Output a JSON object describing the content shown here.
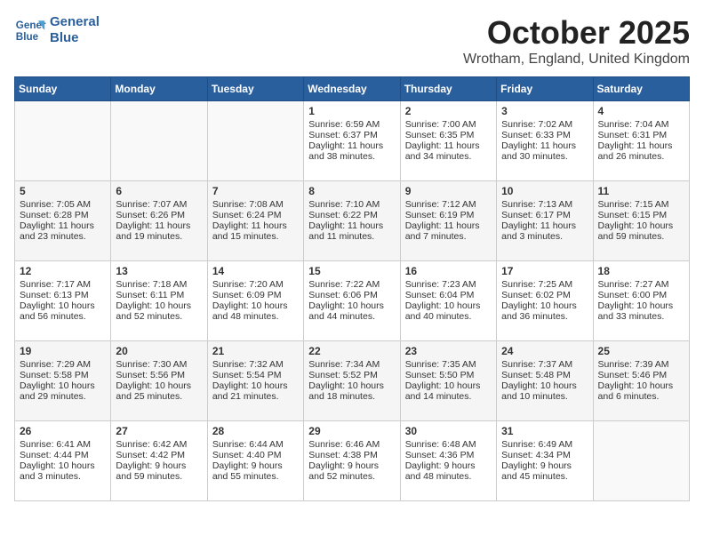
{
  "header": {
    "logo_general": "General",
    "logo_blue": "Blue",
    "month_title": "October 2025",
    "location": "Wrotham, England, United Kingdom"
  },
  "days_of_week": [
    "Sunday",
    "Monday",
    "Tuesday",
    "Wednesday",
    "Thursday",
    "Friday",
    "Saturday"
  ],
  "weeks": [
    [
      {
        "day": "",
        "content": ""
      },
      {
        "day": "",
        "content": ""
      },
      {
        "day": "",
        "content": ""
      },
      {
        "day": "1",
        "content": "Sunrise: 6:59 AM\nSunset: 6:37 PM\nDaylight: 11 hours and 38 minutes."
      },
      {
        "day": "2",
        "content": "Sunrise: 7:00 AM\nSunset: 6:35 PM\nDaylight: 11 hours and 34 minutes."
      },
      {
        "day": "3",
        "content": "Sunrise: 7:02 AM\nSunset: 6:33 PM\nDaylight: 11 hours and 30 minutes."
      },
      {
        "day": "4",
        "content": "Sunrise: 7:04 AM\nSunset: 6:31 PM\nDaylight: 11 hours and 26 minutes."
      }
    ],
    [
      {
        "day": "5",
        "content": "Sunrise: 7:05 AM\nSunset: 6:28 PM\nDaylight: 11 hours and 23 minutes."
      },
      {
        "day": "6",
        "content": "Sunrise: 7:07 AM\nSunset: 6:26 PM\nDaylight: 11 hours and 19 minutes."
      },
      {
        "day": "7",
        "content": "Sunrise: 7:08 AM\nSunset: 6:24 PM\nDaylight: 11 hours and 15 minutes."
      },
      {
        "day": "8",
        "content": "Sunrise: 7:10 AM\nSunset: 6:22 PM\nDaylight: 11 hours and 11 minutes."
      },
      {
        "day": "9",
        "content": "Sunrise: 7:12 AM\nSunset: 6:19 PM\nDaylight: 11 hours and 7 minutes."
      },
      {
        "day": "10",
        "content": "Sunrise: 7:13 AM\nSunset: 6:17 PM\nDaylight: 11 hours and 3 minutes."
      },
      {
        "day": "11",
        "content": "Sunrise: 7:15 AM\nSunset: 6:15 PM\nDaylight: 10 hours and 59 minutes."
      }
    ],
    [
      {
        "day": "12",
        "content": "Sunrise: 7:17 AM\nSunset: 6:13 PM\nDaylight: 10 hours and 56 minutes."
      },
      {
        "day": "13",
        "content": "Sunrise: 7:18 AM\nSunset: 6:11 PM\nDaylight: 10 hours and 52 minutes."
      },
      {
        "day": "14",
        "content": "Sunrise: 7:20 AM\nSunset: 6:09 PM\nDaylight: 10 hours and 48 minutes."
      },
      {
        "day": "15",
        "content": "Sunrise: 7:22 AM\nSunset: 6:06 PM\nDaylight: 10 hours and 44 minutes."
      },
      {
        "day": "16",
        "content": "Sunrise: 7:23 AM\nSunset: 6:04 PM\nDaylight: 10 hours and 40 minutes."
      },
      {
        "day": "17",
        "content": "Sunrise: 7:25 AM\nSunset: 6:02 PM\nDaylight: 10 hours and 36 minutes."
      },
      {
        "day": "18",
        "content": "Sunrise: 7:27 AM\nSunset: 6:00 PM\nDaylight: 10 hours and 33 minutes."
      }
    ],
    [
      {
        "day": "19",
        "content": "Sunrise: 7:29 AM\nSunset: 5:58 PM\nDaylight: 10 hours and 29 minutes."
      },
      {
        "day": "20",
        "content": "Sunrise: 7:30 AM\nSunset: 5:56 PM\nDaylight: 10 hours and 25 minutes."
      },
      {
        "day": "21",
        "content": "Sunrise: 7:32 AM\nSunset: 5:54 PM\nDaylight: 10 hours and 21 minutes."
      },
      {
        "day": "22",
        "content": "Sunrise: 7:34 AM\nSunset: 5:52 PM\nDaylight: 10 hours and 18 minutes."
      },
      {
        "day": "23",
        "content": "Sunrise: 7:35 AM\nSunset: 5:50 PM\nDaylight: 10 hours and 14 minutes."
      },
      {
        "day": "24",
        "content": "Sunrise: 7:37 AM\nSunset: 5:48 PM\nDaylight: 10 hours and 10 minutes."
      },
      {
        "day": "25",
        "content": "Sunrise: 7:39 AM\nSunset: 5:46 PM\nDaylight: 10 hours and 6 minutes."
      }
    ],
    [
      {
        "day": "26",
        "content": "Sunrise: 6:41 AM\nSunset: 4:44 PM\nDaylight: 10 hours and 3 minutes."
      },
      {
        "day": "27",
        "content": "Sunrise: 6:42 AM\nSunset: 4:42 PM\nDaylight: 9 hours and 59 minutes."
      },
      {
        "day": "28",
        "content": "Sunrise: 6:44 AM\nSunset: 4:40 PM\nDaylight: 9 hours and 55 minutes."
      },
      {
        "day": "29",
        "content": "Sunrise: 6:46 AM\nSunset: 4:38 PM\nDaylight: 9 hours and 52 minutes."
      },
      {
        "day": "30",
        "content": "Sunrise: 6:48 AM\nSunset: 4:36 PM\nDaylight: 9 hours and 48 minutes."
      },
      {
        "day": "31",
        "content": "Sunrise: 6:49 AM\nSunset: 4:34 PM\nDaylight: 9 hours and 45 minutes."
      },
      {
        "day": "",
        "content": ""
      }
    ]
  ]
}
